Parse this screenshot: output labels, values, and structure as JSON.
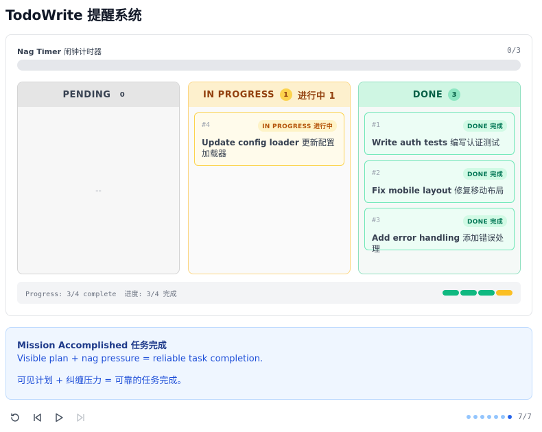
{
  "app": {
    "title": "TodoWrite 提醒系统"
  },
  "timer": {
    "label_en": "Nag Timer",
    "label_zh": "闹钟计时器",
    "count": "0/3",
    "fraction": 0
  },
  "columns": {
    "pending": {
      "label": "PENDING",
      "count": "0",
      "label_zh": "",
      "empty": "--"
    },
    "in_progress": {
      "label": "IN PROGRESS",
      "count": "1",
      "label_zh": "进行中 1"
    },
    "done": {
      "label": "DONE",
      "count": "3",
      "label_zh": ""
    }
  },
  "tasks": {
    "in_progress": [
      {
        "id": "#4",
        "badge": "IN PROGRESS 进行中",
        "title_en": "Update config loader",
        "title_zh": "更新配置加载器"
      }
    ],
    "done": [
      {
        "id": "#1",
        "badge": "DONE 完成",
        "title_en": "Write auth tests",
        "title_zh": "编写认证测试"
      },
      {
        "id": "#2",
        "badge": "DONE 完成",
        "title_en": "Fix mobile layout",
        "title_zh": "修复移动布局"
      },
      {
        "id": "#3",
        "badge": "DONE 完成",
        "title_en": "Add error handling",
        "title_zh": "添加错误处理"
      }
    ]
  },
  "progress": {
    "text": "Progress: 3/4 complete  进度: 3/4 完成",
    "segments": [
      "done",
      "done",
      "done",
      "in_progress"
    ]
  },
  "colors": {
    "done": "#10b981",
    "in_progress": "#fbbf24",
    "pending": "#d1d5db"
  },
  "mission": {
    "title": "Mission Accomplished  任务完成",
    "line1": "Visible plan + nag pressure = reliable task completion.",
    "line2": "可见计划 + 纠缠压力 = 可靠的任务完成。"
  },
  "controls": {
    "icons": [
      "restart-icon",
      "skip-back-icon",
      "play-icon",
      "skip-forward-icon"
    ],
    "page_indicator": "7/7",
    "total_steps": 7,
    "current_step": 7
  }
}
